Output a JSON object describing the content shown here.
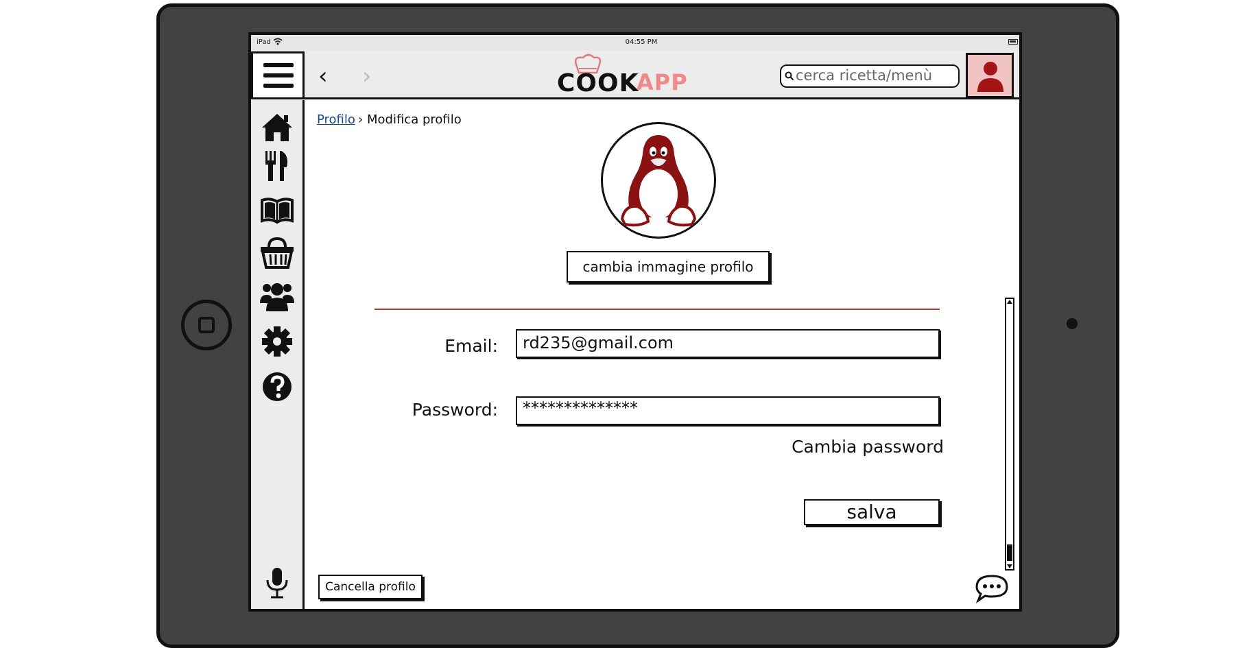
{
  "status_bar": {
    "carrier": "iPad",
    "time": "04:55 PM"
  },
  "header": {
    "logo_left": "COOK",
    "logo_right": "APP",
    "search_placeholder": "cerca ricetta/menù"
  },
  "sidebar": {
    "items": [
      {
        "icon": "home-icon"
      },
      {
        "icon": "fork-knife-icon"
      },
      {
        "icon": "book-icon"
      },
      {
        "icon": "basket-icon"
      },
      {
        "icon": "users-icon"
      },
      {
        "icon": "gear-icon"
      },
      {
        "icon": "help-icon"
      }
    ],
    "bottom_icon": "microphone-icon"
  },
  "breadcrumb": {
    "parent": "Profilo",
    "separator": "›",
    "current": "Modifica profilo"
  },
  "profile": {
    "avatar_icon": "penguin-icon",
    "change_image_label": "cambia immagine profilo"
  },
  "form": {
    "email_label": "Email:",
    "email_value": "rd235@gmail.com",
    "password_label": "Password:",
    "password_value": "**************",
    "change_password_label": "Cambia password",
    "save_label": "salva"
  },
  "footer": {
    "delete_profile_label": "Cancella profilo"
  },
  "colors": {
    "accent": "#a31515",
    "logo_app": "#f08a8a",
    "user_button_bg": "#f2c3c3",
    "frame": "#424242"
  }
}
